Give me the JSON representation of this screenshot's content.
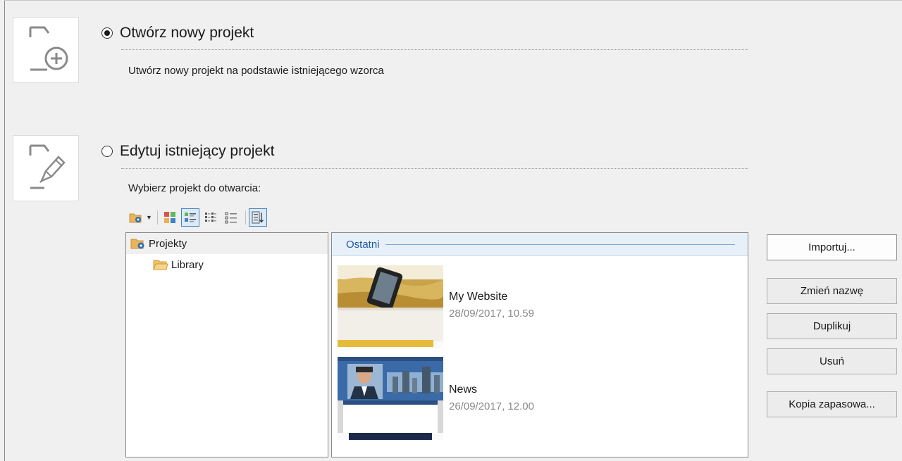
{
  "options": {
    "new_project": {
      "label": "Otwórz nowy projekt",
      "description": "Utwórz nowy projekt na podstawie istniejącego wzorca",
      "selected": true
    },
    "edit_project": {
      "label": "Edytuj istniejący projekt",
      "prompt": "Wybierz projekt do otwarcia:",
      "selected": false
    }
  },
  "toolbar": {
    "buttons": [
      "folder-settings-icon",
      "large-icons-view-icon",
      "details-view-icon",
      "tiles-view-icon",
      "list-view-icon",
      "sort-icon"
    ]
  },
  "tree": {
    "items": [
      {
        "label": "Projekty",
        "icon": "projects-folder-icon",
        "selected": true
      },
      {
        "label": "Library",
        "icon": "folder-icon",
        "selected": false
      }
    ]
  },
  "recent": {
    "header": "Ostatni",
    "projects": [
      {
        "name": "My Website",
        "date": "28/09/2017, 10.59"
      },
      {
        "name": "News",
        "date": "26/09/2017, 12.00"
      }
    ]
  },
  "actions": {
    "import": "Importuj...",
    "rename": "Zmień nazwę",
    "duplicate": "Duplikuj",
    "delete": "Usuń",
    "backup": "Kopia zapasowa..."
  },
  "colors": {
    "accent": "#3c82c8",
    "header_bg": "#e7f0f8",
    "header_text": "#1e5aa0"
  }
}
